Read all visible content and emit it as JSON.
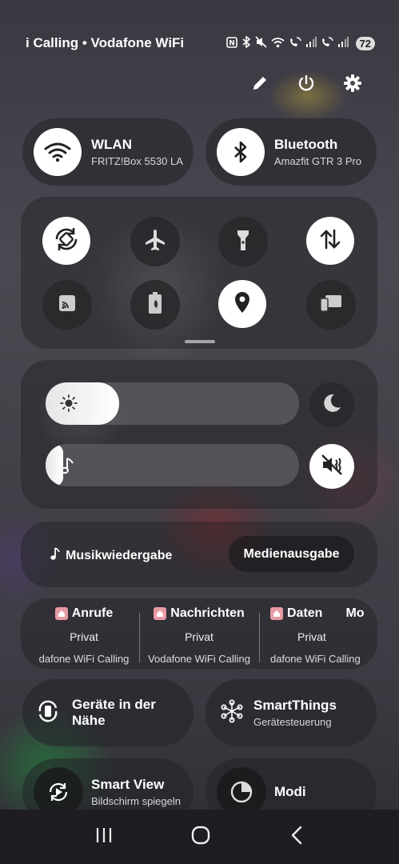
{
  "status_bar": {
    "carrier": "i Calling • Vodafone WiFi",
    "battery": "72",
    "icons": [
      "nfc-icon",
      "bluetooth-icon",
      "mute-icon",
      "wifi-icon",
      "wifi-calling-icon",
      "signal-icon",
      "wifi-calling-2-icon",
      "signal-2-icon"
    ]
  },
  "top_actions": [
    "edit-icon",
    "power-icon",
    "settings-icon"
  ],
  "wlan": {
    "title": "WLAN",
    "subtitle": "FRITZ!Box 5530 LA"
  },
  "bluetooth": {
    "title": "Bluetooth",
    "subtitle": "Amazfit GTR 3 Pro"
  },
  "quick_toggles": [
    {
      "name": "auto-rotate",
      "active": true
    },
    {
      "name": "airplane-mode",
      "active": false
    },
    {
      "name": "flashlight",
      "active": false
    },
    {
      "name": "mobile-data",
      "active": true
    },
    {
      "name": "cast",
      "active": false
    },
    {
      "name": "power-saving",
      "active": false
    },
    {
      "name": "location",
      "active": true
    },
    {
      "name": "second-screen",
      "active": false
    }
  ],
  "sliders": {
    "brightness_level": 0.29,
    "volume_level": 0.06
  },
  "media": {
    "label": "Musikwiedergabe",
    "output_button": "Medienausgabe"
  },
  "sim_profiles": [
    {
      "header": "Anrufe",
      "sim": "Privat",
      "carrier": "dafone WiFi Calling"
    },
    {
      "header": "Nachrichten",
      "sim": "Privat",
      "carrier": "Vodafone WiFi Calling"
    },
    {
      "header": "Daten",
      "sim": "Privat",
      "carrier": "dafone WiFi Calling"
    },
    {
      "header": "Mo"
    }
  ],
  "tiles": {
    "nearby": {
      "title": "Geräte in der Nähe"
    },
    "smartthings": {
      "title": "SmartThings",
      "subtitle": "Gerätesteuerung"
    },
    "smartview": {
      "title": "Smart View",
      "subtitle": "Bildschirm spiegeln"
    },
    "modes": {
      "title": "Modi"
    }
  },
  "colors": {
    "sim_icon": "#e89aa5",
    "active_toggle": "#ffffff"
  }
}
